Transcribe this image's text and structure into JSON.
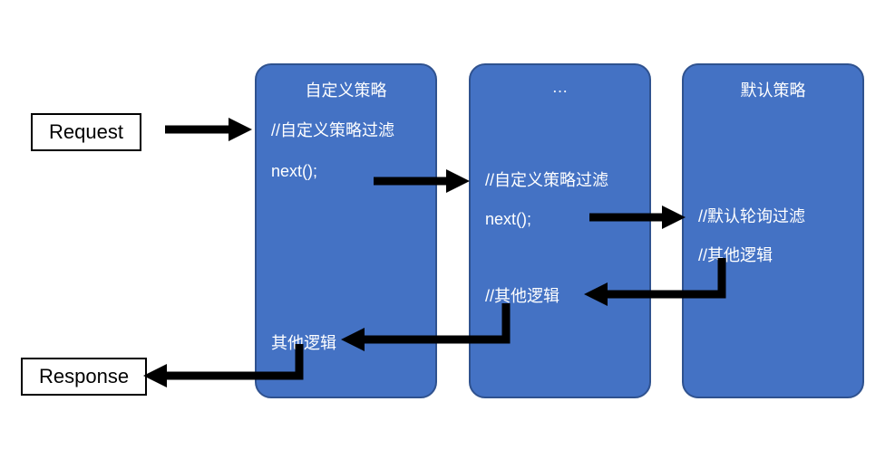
{
  "labels": {
    "request": "Request",
    "response": "Response"
  },
  "boxes": {
    "custom": {
      "title": "自定义策略",
      "filter": "//自定义策略过滤",
      "next": "next();",
      "other": "其他逻辑"
    },
    "mid": {
      "title": "…",
      "filter": "//自定义策略过滤",
      "next": "next();",
      "other": "//其他逻辑"
    },
    "default": {
      "title": "默认策略",
      "poll": "//默认轮询过滤",
      "other": "//其他逻辑"
    }
  }
}
